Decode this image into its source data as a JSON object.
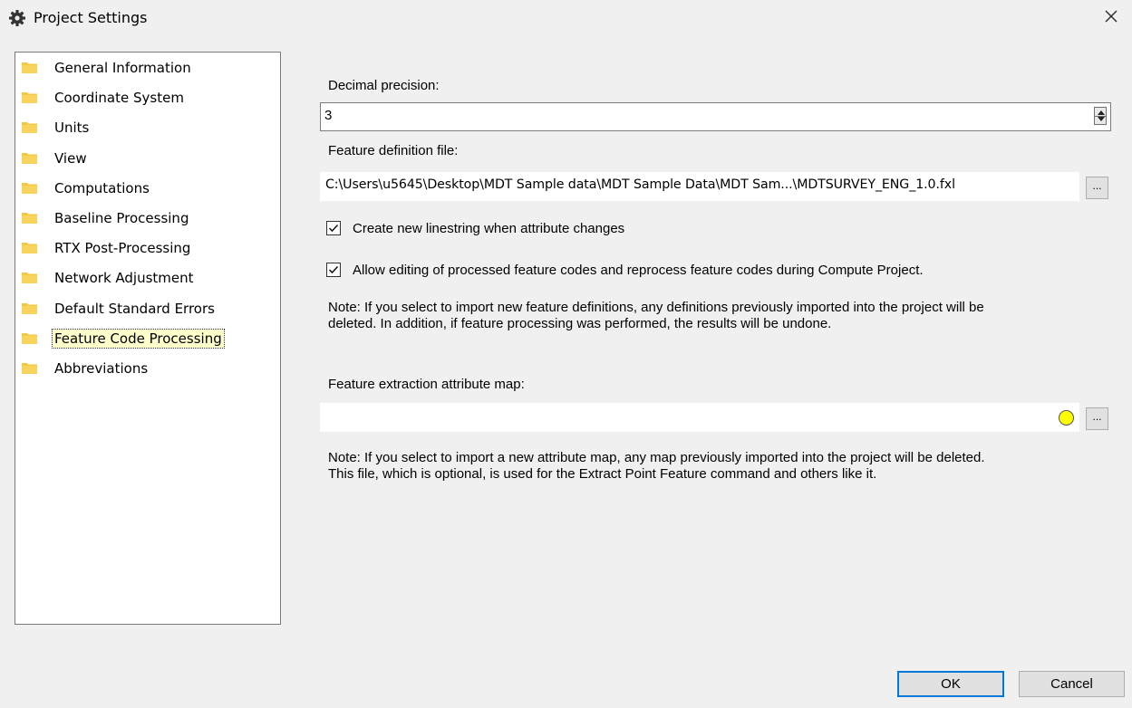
{
  "window": {
    "title": "Project Settings",
    "title_icon": "gear-icon",
    "close_icon": "close-icon"
  },
  "sidebar": {
    "items": [
      {
        "label": "General Information",
        "icon": "folder-icon"
      },
      {
        "label": "Coordinate System",
        "icon": "folder-icon"
      },
      {
        "label": "Units",
        "icon": "folder-icon"
      },
      {
        "label": "View",
        "icon": "folder-icon"
      },
      {
        "label": "Computations",
        "icon": "folder-icon"
      },
      {
        "label": "Baseline Processing",
        "icon": "folder-icon"
      },
      {
        "label": "RTX Post-Processing",
        "icon": "folder-icon"
      },
      {
        "label": "Network Adjustment",
        "icon": "folder-icon"
      },
      {
        "label": "Default Standard Errors",
        "icon": "folder-icon"
      },
      {
        "label": "Feature Code Processing",
        "icon": "folder-icon",
        "selected": true
      },
      {
        "label": "Abbreviations",
        "icon": "folder-icon"
      }
    ]
  },
  "form": {
    "decimal_precision_label": "Decimal precision:",
    "decimal_precision_value": "3",
    "feature_def_label": "Feature definition file:",
    "feature_def_value": "C:\\Users\\u5645\\Desktop\\MDT Sample data\\MDT Sample Data\\MDT Sam...\\MDTSURVEY_ENG_1.0.fxl",
    "browse_label": "...",
    "checkbox_linestring_label": "Create new linestring when attribute changes",
    "checkbox_linestring_checked": true,
    "checkbox_editing_label": "Allow editing of processed feature codes and reprocess feature codes during Compute Project.",
    "checkbox_editing_checked": true,
    "note_feature_defs_line1": "Note: If you select to import new feature definitions, any definitions previously imported into the project will be",
    "note_feature_defs_line2": "deleted. In addition, if feature processing was performed, the results will be undone.",
    "attr_map_label": "Feature extraction attribute map:",
    "attr_map_value": "",
    "attr_map_status_color": "#ffff00",
    "note_attr_map_line1": "Note: If you select to import a new attribute map, any map previously imported into the project will be deleted.",
    "note_attr_map_line2": "This file, which is optional, is used for the Extract Point Feature command and others like it."
  },
  "buttons": {
    "ok": "OK",
    "cancel": "Cancel"
  },
  "colors": {
    "accent": "#0078d7",
    "folder": "#f3c843",
    "selected_bg": "#ffffcc"
  }
}
